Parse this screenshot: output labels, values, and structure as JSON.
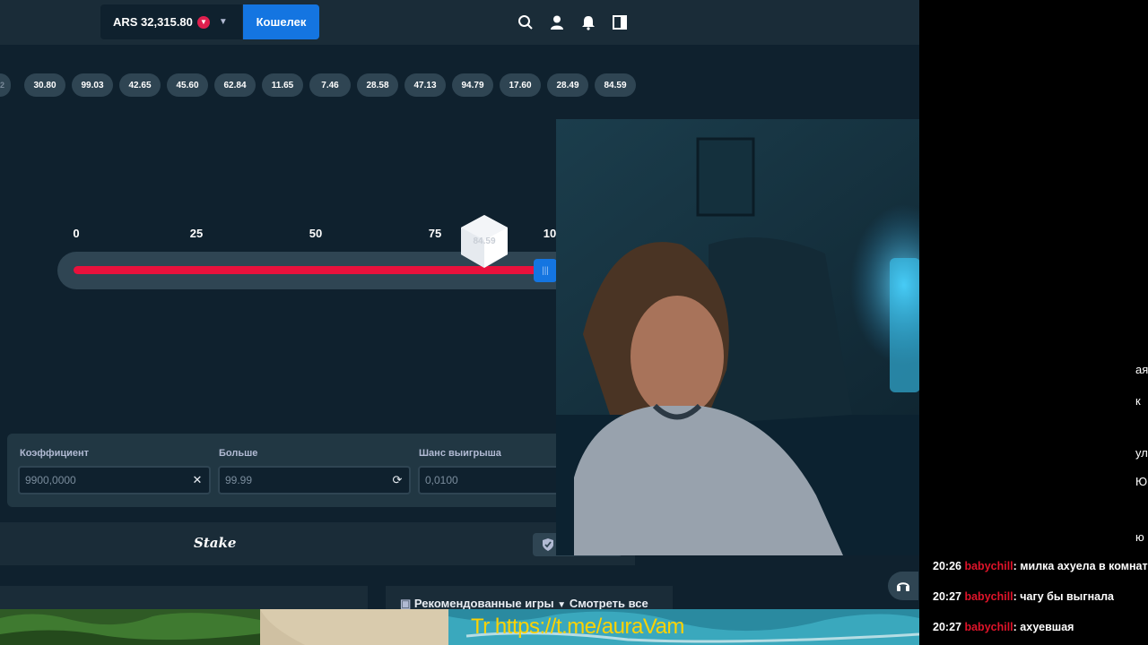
{
  "header": {
    "balance": "ARS 32,315.80",
    "currency_icon": "ars-coin-icon",
    "wallet_label": "Кошелек",
    "icons": [
      "search-icon",
      "user-icon",
      "bell-icon",
      "sidebar-toggle-icon"
    ]
  },
  "history": {
    "partial": "2",
    "values": [
      "30.80",
      "99.03",
      "42.65",
      "45.60",
      "62.84",
      "11.65",
      "7.46",
      "28.58",
      "47.13",
      "94.79",
      "17.60",
      "28.49",
      "84.59"
    ]
  },
  "slider": {
    "ticks": [
      "0",
      "25",
      "50",
      "75",
      "10"
    ],
    "roll_result": "84.59",
    "value_percent": 99.99
  },
  "inputs": {
    "multiplier_label": "Коэффициент",
    "multiplier_value": "9900,0000",
    "roll_label": "Больше",
    "roll_value": "99.99",
    "chance_label": "Шанс выигрыша",
    "chance_value": "0,0100"
  },
  "footer": {
    "logo": "Stake",
    "recommended_label": "Рекомендованные игры",
    "view_all_label": "Смотреть все"
  },
  "chat": {
    "partial_lines": [
      "ая",
      "к",
      "ул",
      "Ю",
      "ю"
    ],
    "messages": [
      {
        "time": "20:26",
        "user": "babychill",
        "text": ": милка ахуела в комнате ку"
      },
      {
        "time": "20:27",
        "user": "babychill",
        "text": ": чагу бы выгнала"
      },
      {
        "time": "20:27",
        "user": "babychill",
        "text": ": ахуевшая"
      }
    ]
  },
  "overlay": {
    "link_text": "Tr https://t.me/auraVam"
  },
  "colors": {
    "accent_blue": "#1475e1",
    "lose_red": "#e9113c",
    "win_green": "#00e701",
    "bg_dark": "#0f212e",
    "panel": "#213743"
  }
}
